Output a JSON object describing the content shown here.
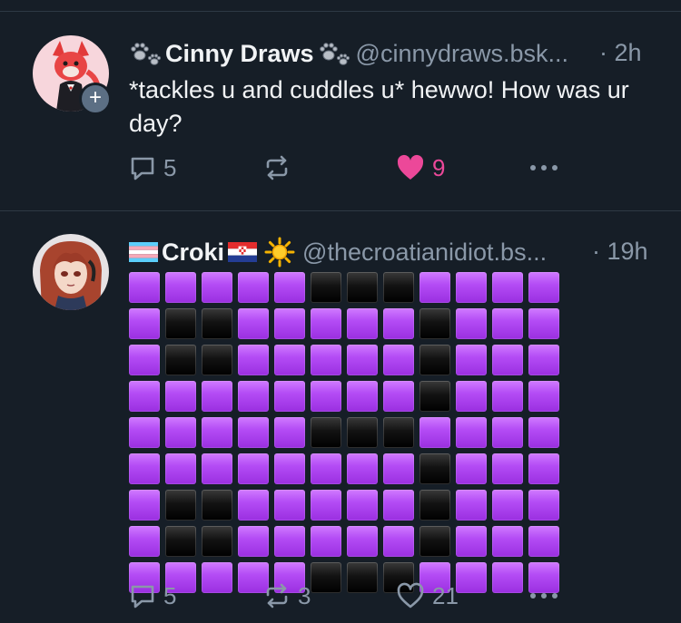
{
  "posts": [
    {
      "author": "Cinny Draws",
      "handle": "@cinnydraws.bsk...",
      "time": "· 2h",
      "text": "*tackles u and cuddles u* hewwo! How was ur day?",
      "replies": "5",
      "reposts": "",
      "likes": "9",
      "liked": true
    },
    {
      "author": "Croki",
      "handle": "@thecroatianidiot.bs...",
      "time": "· 19h",
      "replies": "5",
      "reposts": "3",
      "likes": "21",
      "liked": false,
      "emoji_grid": [
        "PPPPPBBBPPPP",
        "PBBPPPPPBPPP",
        "PBBPPPPPBPPP",
        "PPPPPPPPBPPP",
        "PPPPPBBBPPPP",
        "PPPPPPPPBPPP",
        "PBBPPPPPBPPP",
        "PBBPPPPPBPPP",
        "PPPPPBBBPPPP"
      ]
    }
  ],
  "colors": {
    "background": "#161e27",
    "muted": "#8a98a8",
    "like": "#ec4899",
    "purple_square": "#b44cf5",
    "black_square": "#000000"
  },
  "icons": [
    "paw-icon",
    "reply-icon",
    "repost-icon",
    "heart-icon",
    "more-icon",
    "trans-flag-icon",
    "croatia-flag-icon",
    "sun-icon",
    "plus-icon"
  ]
}
